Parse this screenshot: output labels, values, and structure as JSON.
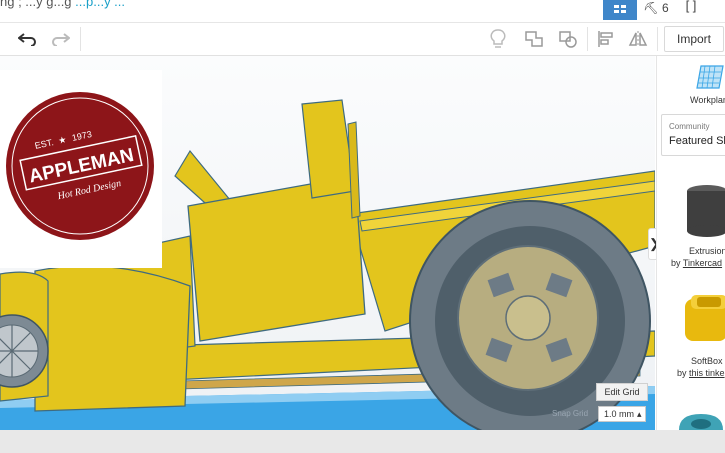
{
  "top": {
    "title_prefix": "ng ; ...y g...g",
    "title_link": "...p...y ...",
    "tool_count": "6"
  },
  "toolbar": {
    "import_label": "Import"
  },
  "logo": {
    "est": "EST.",
    "star": "★",
    "year": "1973",
    "brand": "APPLEMAN",
    "tagline": "Hot Rod Design"
  },
  "sidebar": {
    "workplane_label": "Workplan",
    "community_label": "Community",
    "featured_label": "Featured Sh",
    "items": [
      {
        "name": "Extrusion",
        "by": "by",
        "author": "Tinkercad"
      },
      {
        "name": "SoftBox",
        "by": "by",
        "author": "this tinke"
      }
    ],
    "collapse_glyph": "❯"
  },
  "grid": {
    "edit_grid_label": "Edit Grid",
    "snap_grid_label": "Snap Grid",
    "snap_value": "1.0 mm",
    "snap_arrow": "▴"
  },
  "colors": {
    "accent": "#3f86c9",
    "car_yellow": "#e3c51d",
    "car_outline": "#3f6b80",
    "tire": "#6d7b86",
    "logo_red": "#8d1519",
    "grid_blue": "#3aa5e6"
  }
}
